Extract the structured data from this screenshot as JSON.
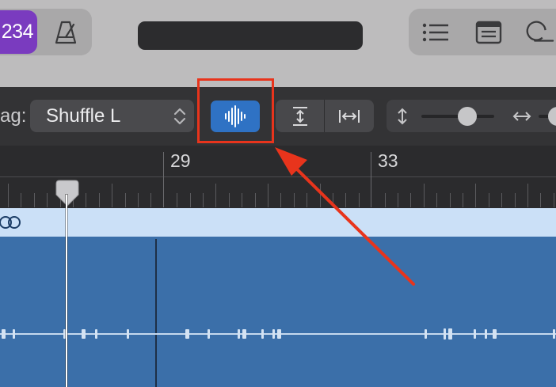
{
  "control_bar": {
    "count_in_display": "234"
  },
  "editor_toolbar": {
    "drag_label": "ag:",
    "drag_mode_value": "Shuffle L"
  },
  "ruler": {
    "bar_numbers": [
      "29",
      "33"
    ]
  },
  "colors": {
    "accent_blue": "#2f72c4",
    "highlight_red": "#e8341c",
    "count_badge_purple": "#7a3bbf",
    "region_blue": "#3b6fa9",
    "region_header": "#cbe0f7"
  },
  "icons": {
    "metronome": "metronome-icon",
    "list": "list-editors-icon",
    "notepad": "note-pad-icon",
    "loops": "loop-browser-icon",
    "flex": "flex-waveform-icon",
    "vertical_zoom": "vertical-zoom-icon",
    "horizontal_zoom": "horizontal-zoom-icon",
    "loop": "loop-region-icon"
  }
}
